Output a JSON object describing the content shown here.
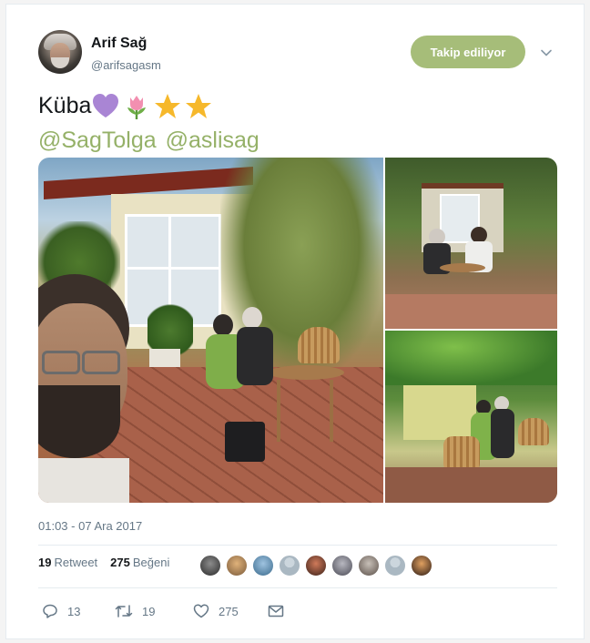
{
  "user": {
    "name": "Arif Sağ",
    "handle": "@arifsagasm"
  },
  "follow_button": {
    "label": "Takip ediliyor"
  },
  "tweet": {
    "text": "Küba",
    "emojis": [
      "purple-heart-icon",
      "tulip-icon",
      "star-icon",
      "star-icon"
    ],
    "mentions": [
      "@SagTolga",
      "@aslisag"
    ]
  },
  "media": {
    "photos": [
      "selfie-garden-photo",
      "patio-table-photo",
      "garden-chairs-photo"
    ]
  },
  "timestamp": "01:03 - 07 Ara 2017",
  "stats": {
    "retweet_count": "19",
    "retweet_label": "Retweet",
    "like_count": "275",
    "like_label": "Beğeni"
  },
  "likers": 9,
  "actions": {
    "reply_count": "13",
    "retweet_count": "19",
    "like_count": "275"
  },
  "colors": {
    "accent": "#95b168",
    "follow_button": "#a6bd79",
    "secondary_text": "#657786",
    "divider": "#e6ecf0"
  }
}
